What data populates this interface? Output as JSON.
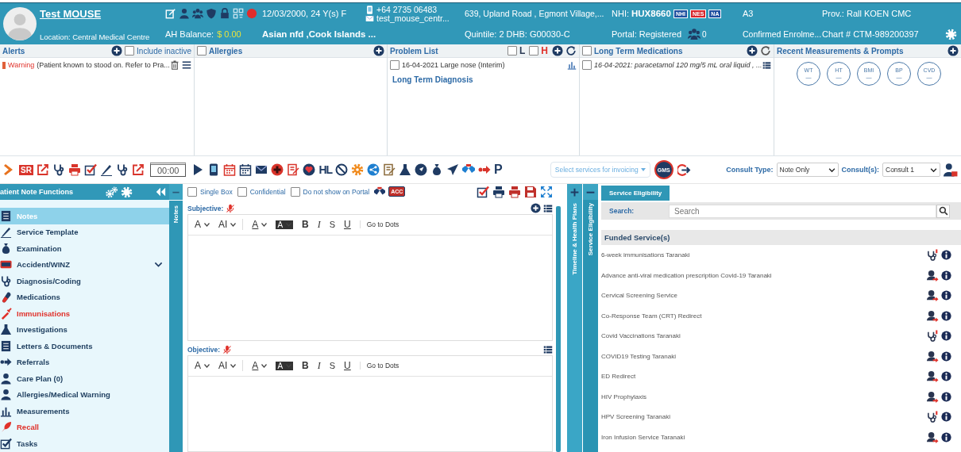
{
  "header": {
    "name": "Test MOUSE",
    "location": "Location: Central Medical Centre",
    "ah_balance_label": "AH Balance:",
    "ah_balance": "$ 0.00",
    "dob": "12/03/2000, 24 Y(s) F",
    "ethnicity": "Asian nfd ,Cook Islands ...",
    "phone": "+64 2735 06483",
    "email": "test_mouse_centr...",
    "address": "639, Upland Road , Egmont Village,...",
    "quintile": "Quintile: 2 DHB: G00030-C",
    "nhi_label": "NHI:",
    "nhi": "HUX8660",
    "nhi_badges": [
      {
        "text": "NHI",
        "color": "#1e4fa0"
      },
      {
        "text": "NES",
        "color": "#d8262c"
      },
      {
        "text": "NA",
        "color": "#1e4fa0"
      }
    ],
    "portal": "Portal: Registered",
    "portal_count": "0",
    "code": "A3",
    "enrolment": "Confirmed Enrolme...",
    "provider": "Prov.: Rall KOEN CMC",
    "chart": "Chart # CTM-989200397"
  },
  "alerts": {
    "title": "Alerts",
    "include_inactive": {
      "label": "Include inactive",
      "checked": false
    },
    "items": [
      {
        "label": "Warning",
        "text": "(Patient known to stood on. Refer to Pra..."
      }
    ]
  },
  "allergies": {
    "title": "Allergies",
    "checked": false
  },
  "problem_list": {
    "title": "Problem List",
    "filters": [
      {
        "label": "L",
        "checked": false,
        "color": "#2b3a55"
      },
      {
        "label": "H",
        "checked": false,
        "color": "#e0322b"
      }
    ],
    "items": [
      {
        "text": "16-04-2021 Large nose (Interim)",
        "checked": false
      }
    ],
    "section": "Long Term Diagnosis"
  },
  "long_term_medications": {
    "title": "Long Term Medications",
    "checked": false,
    "items": [
      {
        "text": "16-04-2021: paracetamol 120 mg/5 mL oral liquid , ...",
        "checked": false
      }
    ]
  },
  "recent_measurements": {
    "title": "Recent Measurements & Prompts",
    "prompts": [
      {
        "label": "WT",
        "value": "—"
      },
      {
        "label": "HT",
        "value": "—"
      },
      {
        "label": "BMI",
        "value": "—"
      },
      {
        "label": "BP",
        "value": "—"
      },
      {
        "label": "CVD",
        "value": "—"
      }
    ]
  },
  "toolbar": {
    "sr_badge": "SR",
    "timer": "00:00",
    "hl_badge": "HL",
    "p_badge": "P",
    "invoice_select": "Select services for invoicing",
    "gms_badge": "GMS",
    "consult_type_label": "Consult Type:",
    "consult_type": "Note Only",
    "consults_label": "Consult(s):",
    "consult": "Consult 1"
  },
  "sidebar": {
    "title": "atient Note Functions",
    "collapse_tab": "Notes",
    "items": [
      {
        "label": "Notes",
        "selected": true,
        "flagged": false,
        "expandable": false
      },
      {
        "label": "Service Template",
        "selected": false,
        "flagged": false,
        "expandable": false
      },
      {
        "label": "Examination",
        "selected": false,
        "flagged": false,
        "expandable": false
      },
      {
        "label": "Accident/WINZ",
        "selected": false,
        "flagged": false,
        "expandable": true
      },
      {
        "label": "Diagnosis/Coding",
        "selected": false,
        "flagged": false,
        "expandable": false
      },
      {
        "label": "Medications",
        "selected": false,
        "flagged": false,
        "expandable": false
      },
      {
        "label": "Immunisations",
        "selected": false,
        "flagged": true,
        "expandable": false
      },
      {
        "label": "Investigations",
        "selected": false,
        "flagged": false,
        "expandable": false
      },
      {
        "label": "Letters & Documents",
        "selected": false,
        "flagged": false,
        "expandable": false
      },
      {
        "label": "Referrals",
        "selected": false,
        "flagged": false,
        "expandable": false
      },
      {
        "label": "Care Plan (0)",
        "selected": false,
        "flagged": false,
        "expandable": false
      },
      {
        "label": "Allergies/Medical Warning",
        "selected": false,
        "flagged": false,
        "expandable": false
      },
      {
        "label": "Measurements",
        "selected": false,
        "flagged": false,
        "expandable": false
      },
      {
        "label": "Recall",
        "selected": false,
        "flagged": true,
        "expandable": false
      },
      {
        "label": "Tasks",
        "selected": false,
        "flagged": false,
        "expandable": false
      }
    ]
  },
  "note": {
    "options": [
      {
        "label": "Single Box",
        "checked": false
      },
      {
        "label": "Confidential",
        "checked": false
      },
      {
        "label": "Do not show on Portal",
        "checked": false
      }
    ],
    "acc_badge": "ACC",
    "sections": [
      {
        "label": "Subjective:",
        "tools": [
          {
            "kind": "font-size",
            "text": "A"
          },
          {
            "kind": "font-family",
            "text": "AI"
          },
          {
            "kind": "font-color",
            "text": "A"
          },
          {
            "kind": "highlight",
            "text": "A"
          },
          {
            "kind": "bold",
            "text": "B"
          },
          {
            "kind": "italic",
            "text": "I"
          },
          {
            "kind": "strike",
            "text": "S"
          },
          {
            "kind": "underline",
            "text": "U"
          },
          {
            "kind": "link",
            "text": "Go to Dots"
          }
        ]
      },
      {
        "label": "Objective:",
        "tools": [
          {
            "kind": "font-size",
            "text": "A"
          },
          {
            "kind": "font-family",
            "text": "AI"
          },
          {
            "kind": "font-color",
            "text": "A"
          },
          {
            "kind": "highlight",
            "text": "A"
          },
          {
            "kind": "bold",
            "text": "B"
          },
          {
            "kind": "italic",
            "text": "I"
          },
          {
            "kind": "strike",
            "text": "S"
          },
          {
            "kind": "underline",
            "text": "U"
          },
          {
            "kind": "link",
            "text": "Go to Dots"
          }
        ]
      }
    ]
  },
  "side_tabs": [
    {
      "label": "Timeline & Health Plans"
    },
    {
      "label": "Service Eligibility"
    }
  ],
  "service_eligibility": {
    "tab": "Service Eligibility",
    "search_label": "Search:",
    "search_placeholder": "Search",
    "section": "Funded Service(s)",
    "services": [
      {
        "name": "6-week immunisations Taranaki",
        "kind": "clinical"
      },
      {
        "name": "Advance anti-viral medication prescription Covid-19 Taranaki",
        "kind": "referral"
      },
      {
        "name": "Cervical Screening Service",
        "kind": "referral"
      },
      {
        "name": "Co-Response Team (CRT) Redirect",
        "kind": "referral"
      },
      {
        "name": "Covid Vaccinations Taranaki",
        "kind": "clinical"
      },
      {
        "name": "COVID19 Testing Taranaki",
        "kind": "referral"
      },
      {
        "name": "ED Redirect",
        "kind": "referral"
      },
      {
        "name": "HIV Prophylaxis",
        "kind": "referral"
      },
      {
        "name": "HPV Screening Taranaki",
        "kind": "clinical"
      },
      {
        "name": "Iron Infusion Service Taranaki",
        "kind": "referral"
      }
    ]
  }
}
